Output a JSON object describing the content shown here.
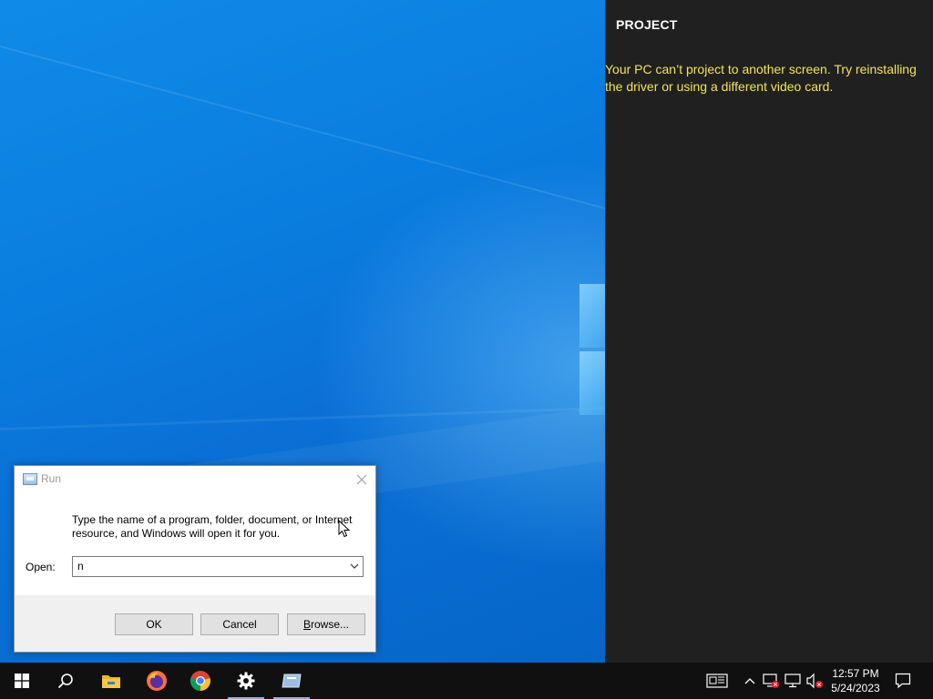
{
  "project_pane": {
    "title": "PROJECT",
    "message": "Your PC can’t project to another screen. Try reinstalling the driver or using a different video card.",
    "message_color": "#f1e35a"
  },
  "run_dialog": {
    "title": "Run",
    "description": "Type the name of a program, folder, document, or Internet resource, and Windows will open it for you.",
    "open_label": "Open:",
    "open_value": "n",
    "ok_label": "OK",
    "cancel_label": "Cancel",
    "browse_label": "Browse..."
  },
  "taskbar": {
    "items": [
      "start-icon",
      "search-icon",
      "file-explorer-icon",
      "firefox-icon",
      "chrome-icon",
      "settings-icon",
      "run-app-icon"
    ],
    "active_items": [
      "settings-icon",
      "run-app-icon"
    ],
    "accent": "#76b9ed",
    "clock_time": "12:57 PM",
    "clock_date": "5/24/2023"
  },
  "tray": {
    "icons": [
      "news-icon",
      "chevron-up-icon",
      "network-error-icon",
      "display-icon",
      "volume-muted-icon",
      "notification-icon"
    ]
  }
}
